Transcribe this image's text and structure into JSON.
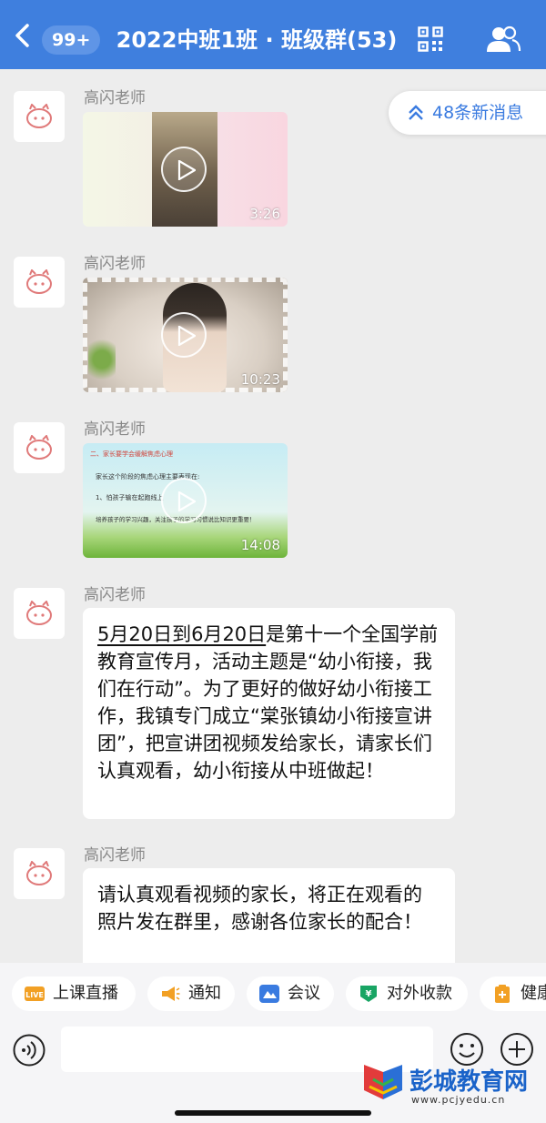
{
  "header": {
    "unread_count": "99+",
    "title": "2022中班1班 · 班级群(53)"
  },
  "new_messages": {
    "label": "48条新消息"
  },
  "messages": [
    {
      "sender": "高闪老师",
      "type": "video",
      "duration": "3:26"
    },
    {
      "sender": "高闪老师",
      "type": "video",
      "duration": "10:23"
    },
    {
      "sender": "高闪老师",
      "type": "video",
      "duration": "14:08",
      "slide": {
        "heading": "二、家长要学会缓解焦虑心理",
        "line1": "家长这个阶段的焦虑心理主要表现在:",
        "line2": "1、怕孩子输在起跑线上",
        "line3": "培养孩子的学习兴趣，关注孩子的学习习惯说比知识更重要！"
      }
    },
    {
      "sender": "高闪老师",
      "type": "text",
      "text_link": "5月20日到6月20日",
      "text_rest": "是第十一个全国学前教育宣传月，活动主题是“幼小衔接，我们在行动”。为了更好的做好幼小衔接工作，我镇专门成立“棠张镇幼小衔接宣讲团”，把宣讲团视频发给家长，请家长们认真观看，幼小衔接从中班做起！"
    },
    {
      "sender": "高闪老师",
      "type": "text",
      "text": "请认真观看视频的家长，将正在观看的照片发在群里，感谢各位家长的配合！"
    }
  ],
  "toolbar": {
    "apps": [
      {
        "label": "上课直播",
        "icon": "live-icon",
        "badge": "LIVE"
      },
      {
        "label": "通知",
        "icon": "megaphone-icon"
      },
      {
        "label": "会议",
        "icon": "meeting-icon"
      },
      {
        "label": "对外收款",
        "icon": "payment-icon",
        "badge": "¥"
      },
      {
        "label": "健康",
        "icon": "health-icon"
      }
    ],
    "input_placeholder": ""
  },
  "watermark": {
    "name": "彭城教育网",
    "url": "www.pcjyedu.cn"
  },
  "colors": {
    "header_bg": "#3f7fde",
    "accent_blue": "#3a7be0",
    "chat_bg": "#ededed",
    "watermark_blue": "#1a63c9"
  }
}
